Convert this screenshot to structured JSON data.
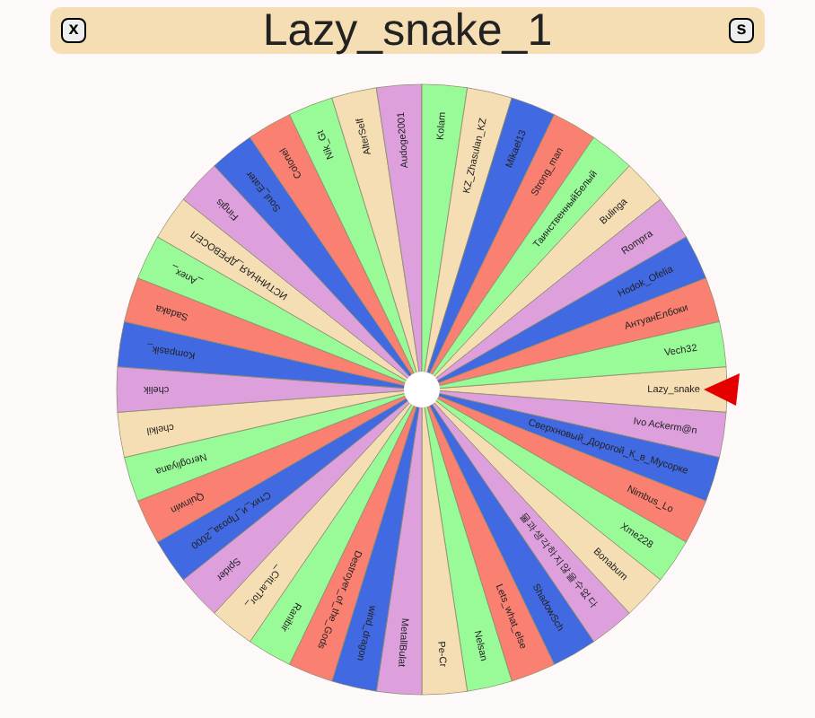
{
  "header": {
    "close_label": "x",
    "title": "Lazy_snake_1",
    "s_label": "s"
  },
  "wheel": {
    "segments": [
      {
        "name": "Lazy_snake",
        "color": "#f5deb3"
      },
      {
        "name": "Ivo Ackerm@n",
        "color": "#dda0dd"
      },
      {
        "name": "Сверхновый_Дорогой_К_в_Мусорке",
        "color": "#4169e1"
      },
      {
        "name": "Nimbus_Lo",
        "color": "#fa8072"
      },
      {
        "name": "Xme228",
        "color": "#98fb98"
      },
      {
        "name": "Bonabum",
        "color": "#f5deb3"
      },
      {
        "name": "물과생각하지않을수없다",
        "color": "#dda0dd"
      },
      {
        "name": "ShadowSch",
        "color": "#4169e1"
      },
      {
        "name": "Lets_what_else",
        "color": "#fa8072"
      },
      {
        "name": "Nelsan",
        "color": "#98fb98"
      },
      {
        "name": "Pe-Cr",
        "color": "#f5deb3"
      },
      {
        "name": "MetallBulat",
        "color": "#dda0dd"
      },
      {
        "name": "wind_dragon",
        "color": "#4169e1"
      },
      {
        "name": "Destroyer_of_the_Gods",
        "color": "#fa8072"
      },
      {
        "name": "Ranibir",
        "color": "#98fb98"
      },
      {
        "name": "_CitLarTor_",
        "color": "#f5deb3"
      },
      {
        "name": "Spider",
        "color": "#dda0dd"
      },
      {
        "name": "Стих_и_Проза_2000",
        "color": "#4169e1"
      },
      {
        "name": "Quinwin",
        "color": "#fa8072"
      },
      {
        "name": "Nerogliyana",
        "color": "#98fb98"
      },
      {
        "name": "chelkil",
        "color": "#f5deb3"
      },
      {
        "name": "chelik",
        "color": "#dda0dd"
      },
      {
        "name": "Kompasik_",
        "color": "#4169e1"
      },
      {
        "name": "Sadaka",
        "color": "#fa8072"
      },
      {
        "name": "_Anex_",
        "color": "#98fb98"
      },
      {
        "name": "ИСТИННАЯ_ДРЕВОСЕЛ",
        "color": "#f5deb3"
      },
      {
        "name": "Fingis",
        "color": "#dda0dd"
      },
      {
        "name": "Soul_Eater",
        "color": "#4169e1"
      },
      {
        "name": "Colonel",
        "color": "#fa8072"
      },
      {
        "name": "Nik_Gt",
        "color": "#98fb98"
      },
      {
        "name": "AlterSelf",
        "color": "#f5deb3"
      },
      {
        "name": "Audoge2001",
        "color": "#dda0dd"
      },
      {
        "name": "Kolam",
        "color": "#98fb98"
      },
      {
        "name": "KZ_Zhasulan_KZ",
        "color": "#f5deb3"
      },
      {
        "name": "Mikael13",
        "color": "#4169e1"
      },
      {
        "name": "Strong_man",
        "color": "#fa8072"
      },
      {
        "name": "ТаинственныйБелый",
        "color": "#98fb98"
      },
      {
        "name": "Bulinga",
        "color": "#f5deb3"
      },
      {
        "name": "Rompra",
        "color": "#dda0dd"
      },
      {
        "name": "Hodok_Ofelia",
        "color": "#4169e1"
      },
      {
        "name": "АнтуанЕлбоки",
        "color": "#fa8072"
      },
      {
        "name": "Vech32",
        "color": "#98fb98"
      }
    ]
  }
}
